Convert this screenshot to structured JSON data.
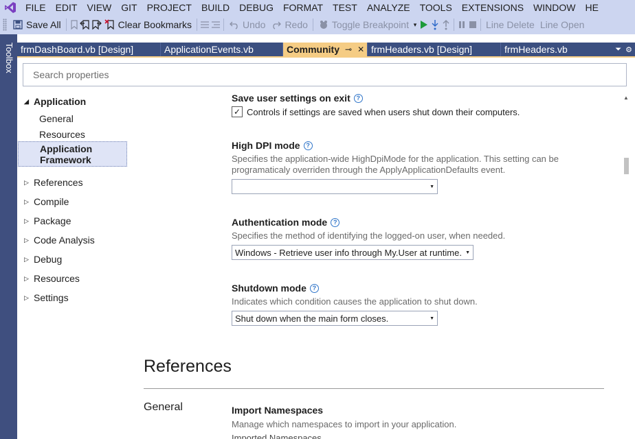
{
  "menu": {
    "items": [
      "FILE",
      "EDIT",
      "VIEW",
      "GIT",
      "PROJECT",
      "BUILD",
      "DEBUG",
      "FORMAT",
      "TEST",
      "ANALYZE",
      "TOOLS",
      "EXTENSIONS",
      "WINDOW",
      "HE"
    ]
  },
  "toolbar": {
    "save_all": "Save All",
    "clear_bookmarks": "Clear Bookmarks",
    "undo": "Undo",
    "redo": "Redo",
    "toggle_breakpoint": "Toggle Breakpoint",
    "line_delete": "Line Delete",
    "line_open": "Line Open"
  },
  "toolbox": {
    "label": "Toolbox"
  },
  "tabs": [
    {
      "label": "frmDashBoard.vb [Design]"
    },
    {
      "label": "ApplicationEvents.vb"
    },
    {
      "label": "Community",
      "active": true
    },
    {
      "label": "frmHeaders.vb [Design]"
    },
    {
      "label": "frmHeaders.vb"
    }
  ],
  "search": {
    "placeholder": "Search properties"
  },
  "nav": {
    "application": "Application",
    "children": [
      "General",
      "Resources",
      "Application Framework"
    ],
    "selected_line1": "Application",
    "selected_line2": "Framework",
    "groups": [
      "References",
      "Compile",
      "Package",
      "Code Analysis",
      "Debug",
      "Resources",
      "Settings"
    ]
  },
  "settings": {
    "save_user_settings": {
      "title": "Save user settings on exit",
      "checkbox_label": "Controls if settings are saved when users shut down their computers.",
      "checked": true
    },
    "high_dpi": {
      "title": "High DPI mode",
      "desc_line1": "Specifies the application-wide HighDpiMode for the application. This setting can be",
      "desc_line2": "programaticaly overriden through the ApplyApplicationDefaults event.",
      "value": ""
    },
    "auth": {
      "title": "Authentication mode",
      "desc": "Specifies the method of identifying the logged-on user, when needed.",
      "value": "Windows - Retrieve user info through My.User at runtime."
    },
    "shutdown": {
      "title": "Shutdown mode",
      "desc": "Indicates which condition causes the application to shut down.",
      "value": "Shut down when the main form closes."
    }
  },
  "references": {
    "heading": "References",
    "general": "General",
    "import_title": "Import Namespaces",
    "import_desc": "Manage which namespaces to import in your application.",
    "imported_label": "Imported Namespaces"
  },
  "colors": {
    "chrome": "#ccd5f0",
    "tab_strip": "#3b4f80",
    "active_tab": "#f5cc84",
    "toolbox": "#3f4f7f",
    "selection": "#dfe4f6"
  }
}
